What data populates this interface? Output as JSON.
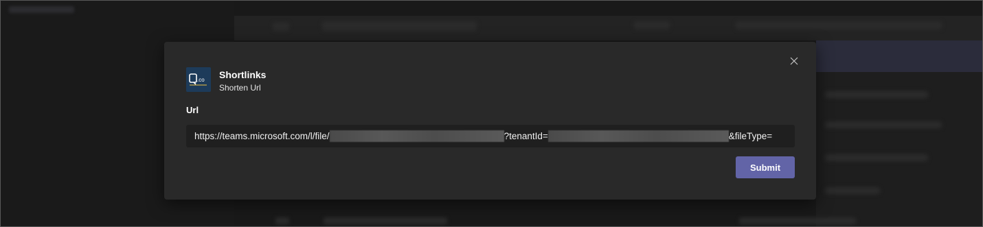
{
  "dialog": {
    "app_name": "Shortlinks",
    "app_subtitle": "Shorten Url",
    "app_icon_text": ".co",
    "field_label": "Url",
    "url_value": {
      "part1": "https://teams.microsoft.com/l/file/",
      "part2": "?tenantId=",
      "part3": "&fileType="
    },
    "submit_label": "Submit"
  },
  "colors": {
    "accent": "#6264a7",
    "dialog_bg": "#292929",
    "input_bg": "#1f1f1f",
    "icon_bg": "#1d3b5a"
  },
  "icons": {
    "close": "close-icon",
    "app": "shortlinks-app-icon"
  }
}
